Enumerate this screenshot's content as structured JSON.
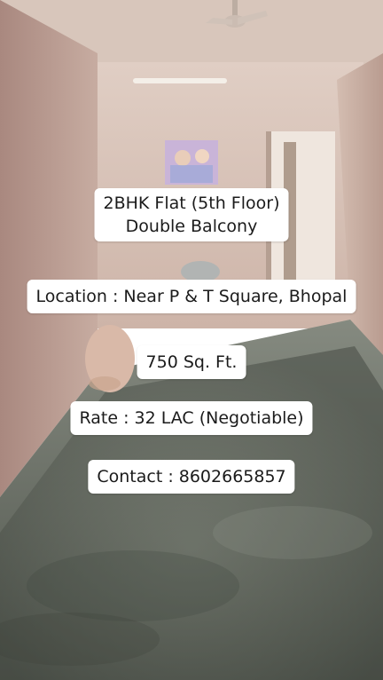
{
  "captions": {
    "title_line1": "2BHK Flat (5th Floor)",
    "title_line2": "Double Balcony",
    "location": "Location : Near P & T Square, Bhopal",
    "area": "750 Sq. Ft.",
    "rate": "Rate : 32 LAC  (Negotiable)",
    "contact": "Contact : 8602665857"
  },
  "colors": {
    "wall": "#c9aea3",
    "ceiling": "#e1d2c8",
    "floor": "#6b7066",
    "caption_bg": "#ffffff",
    "caption_text": "#1b1b1b"
  }
}
